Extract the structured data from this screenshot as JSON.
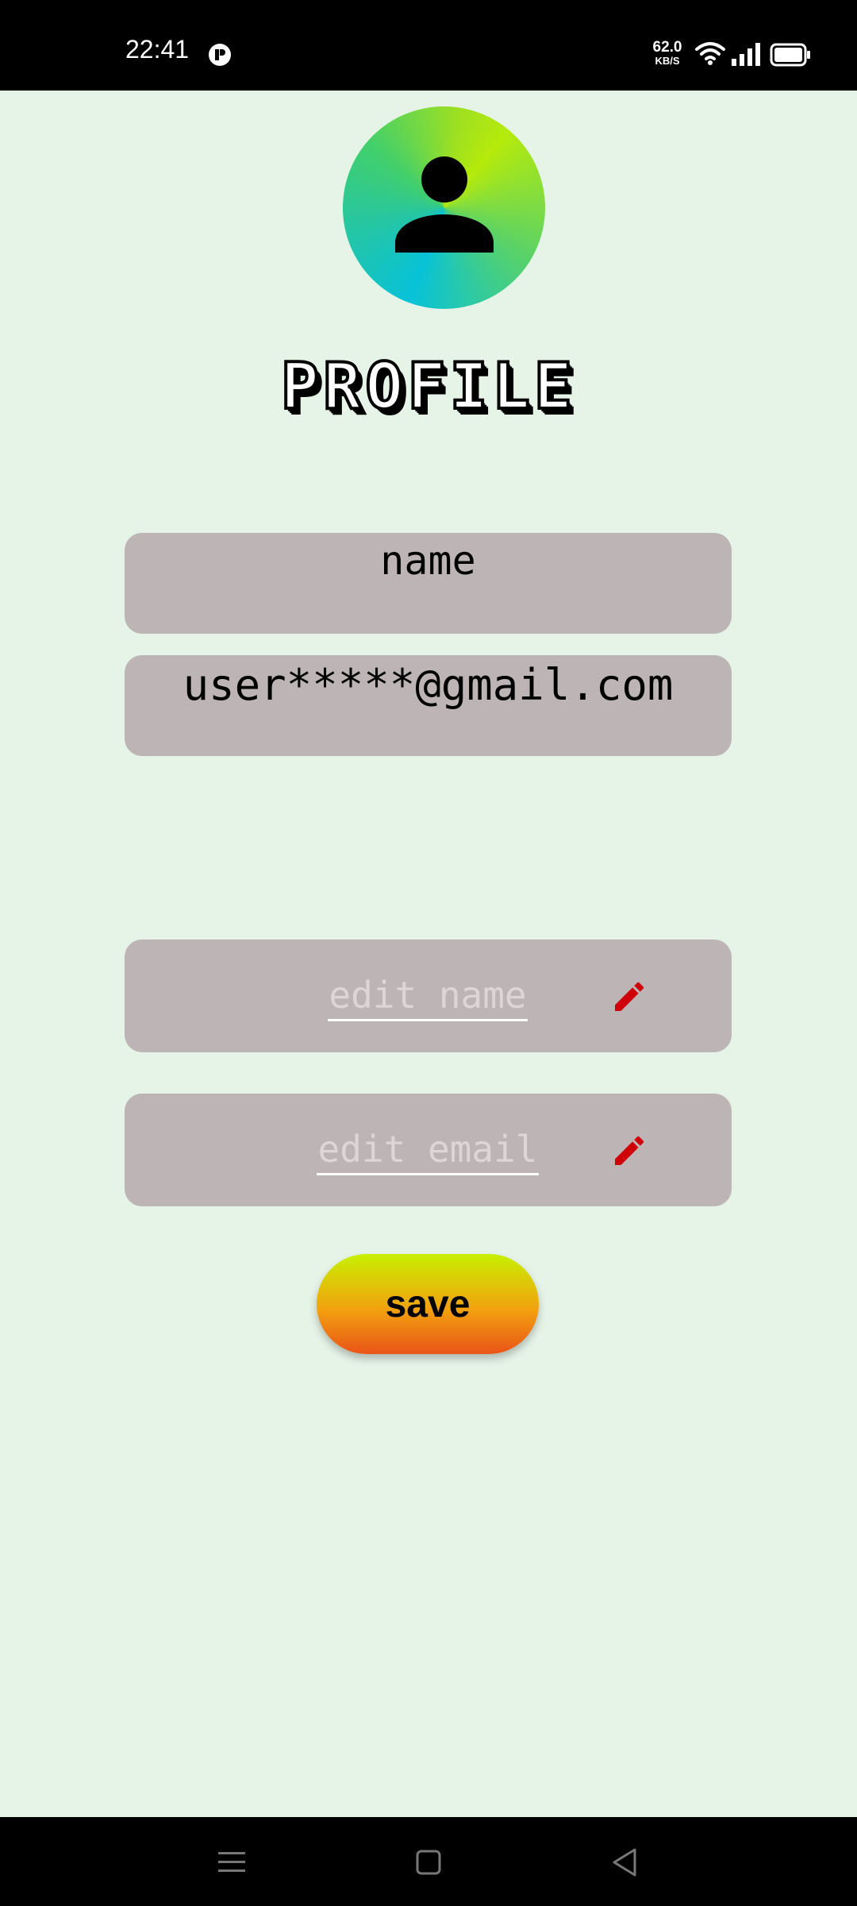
{
  "status_bar": {
    "time": "22:41",
    "net_speed_value": "62.0",
    "net_speed_unit": "KB/S"
  },
  "profile": {
    "title": "PROFILE",
    "name": "name",
    "email": "user*****@gmail.com"
  },
  "edit": {
    "name_placeholder": "edit name",
    "email_placeholder": "edit email"
  },
  "save_label": "save",
  "colors": {
    "background": "#e6f4e8",
    "field_bg": "#bdb5b5",
    "pencil": "#d0000a",
    "save_top": "#c8f000",
    "save_bottom": "#ea5418"
  },
  "icons": [
    "person-icon",
    "pencil-icon",
    "wifi-icon",
    "signal-icon",
    "battery-icon",
    "menu-icon",
    "home-icon",
    "back-icon"
  ]
}
